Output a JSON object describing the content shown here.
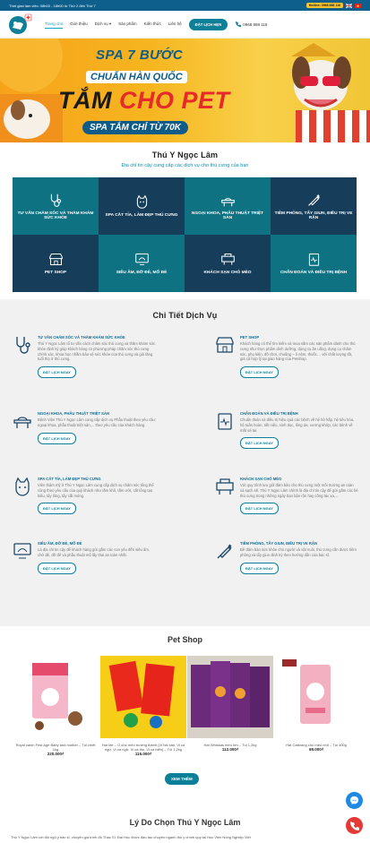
{
  "topbar": {
    "hours": "Thời gian làm việc: 08h00 - 18h00 từ Thứ 2 đến Thứ 7",
    "hotline_label": "Hotline: 0968 888 118"
  },
  "nav": {
    "items": [
      "Trang chủ",
      "Giới thiệu",
      "Dịch vụ",
      "Sản phẩm",
      "Kiến thức",
      "Liên hệ"
    ],
    "book": "ĐẶT LỊCH HẸN",
    "phone": "0968 888 118"
  },
  "banner": {
    "line1": "SPA 7 BƯỚC",
    "line2": "CHUẨN HÀN QUỐC",
    "line3a": "TẮM ",
    "line3b": "CHO PET",
    "line4": "SPA TẮM CHỈ TỪ 70K"
  },
  "intro": {
    "title": "Thú Y Ngọc Lâm",
    "subtitle": "Địa chỉ tin cậy cung cấp các dịch vụ cho thú cưng của bạn"
  },
  "services": [
    "TƯ VẤN CHĂM SÓC VÀ THĂM KHÁM SỨC KHỎE",
    "SPA CẮT TỈA, LÀM ĐẸP THÚ CƯNG",
    "NGOẠI KHOA, PHẪU THUẬT TRIỆT SẢN",
    "TIÊM PHÒNG, TẨY GIUN, ĐIỀU TRỊ VE RẬN",
    "PET SHOP",
    "SIÊU ÂM, ĐỠ ĐẺ, MỔ ĐẺ",
    "KHÁCH SẠN CHÓ MÈO",
    "CHẨN ĐOÁN VÀ ĐIỀU TRỊ BỆNH"
  ],
  "details": {
    "title": "Chi Tiết Dịch Vụ",
    "book": "ĐẶT LỊCH NGAY",
    "items": [
      {
        "h": "TƯ VẤN CHĂM SÓC VÀ THĂM KHÁM SỨC KHỎE",
        "p": "Thú Y Ngọc Lâm tổ tư vấn cách chăm sóc thú cưng và thăm khám sức khỏe định kỳ giúp khách hàng có phương pháp chăm sóc thú cưng chính xác, khoa học nhằm bảo vệ sức khỏe của thú cưng và giá tăng tuổi thọ ở thú cưng."
      },
      {
        "h": "PET SHOP",
        "p": "Khách hàng có thể tìm kiếm và mua sắm các sản phẩm dành cho thú cưng như thực phẩm dinh dưỡng, dụng cụ ăn uống, dụng cụ chăm sóc, phụ kiện, đồ chơi, chuồng – ô nệm, thuốc… với chất lượng tốt, giá cả hợp lý tại giao hàng của Petshop."
      },
      {
        "h": "NGOẠI KHOA, PHẪU THUẬT TRIỆT SẢN",
        "p": "Bệnh Viện Thú Y Ngọc Lâm cung cấp dịch vụ Phẫu thuật theo yêu cầu: ngoại khoa, phẫu thuật triệt sản,... theo yêu cầu của khách hàng."
      },
      {
        "h": "CHẨN ĐOÁN VÀ ĐIỀU TRỊ BỆNH",
        "p": "Chuẩn đoán và điều trị hiệu quả các bệnh về hệ hô hấp, hệ tiêu hóa, hệ tuần hoàn, tiết niệu, sinh dục, lông da, xương khớp, các bệnh về mắt và tai."
      },
      {
        "h": "SPA CẮT TỈA, LÀM ĐẸP THÚ CƯNG",
        "p": "Viên thảm mỹ ở Thú Y Ngọc Lâm cung cấp dịch vụ chăm sóc tổng thể cùng theo yêu cầu của quý khách như tắm khô, tắm ướt, cắt lông tạo kiểu, tẩy lông, tẩy cắt móng."
      },
      {
        "h": "KHÁCH SẠN CHÓ MÈO",
        "p": "Với quy trình lưu giữ đảm bảo cho thú cưng một môi trường an toàn và sạch sẽ. Thú Y Ngọc Lâm chính là địa chỉ tin cậy để gửi gắm các bé thú cưng trong những ngày bạn bận rộn hay công tác xa,..."
      },
      {
        "h": "SIÊU ÂM, ĐỠ ĐẺ, MỔ ĐẺ",
        "p": "Là địa chỉ tin cậy để khách hàng gửi gắm các con yêu đến siêu âm, chờ đẻ, đỡ đẻ và phẫu thuật mổ lấy thai an toàn nhất."
      },
      {
        "h": "TIÊM PHÒNG, TẨY GIUN, ĐIỀU TRỊ VE RẬN",
        "p": "Đề đảm bảo sức khỏe cho người và vật nuôi, thú cưng cần được tiêm phòng và tẩy giun định kỳ theo hướng dẫn của bác sĩ."
      }
    ]
  },
  "shop": {
    "title": "Pet Shop",
    "products": [
      {
        "name": "Royal canin First Age Baby and mother – Túi chiết 1kg",
        "price": "220.000₫"
      },
      {
        "name": "Hạt Me – O cho mèo trưởng thành (Vị hải sản, Vị cá ngừ, Vị cá ngừ, Vị cá thu, Vị cá biển) – Túi 1,2kg",
        "price": "115.000₫"
      },
      {
        "name": "Hạt Whiskas mèo lớn – Túi 1,2kg",
        "price": "112.000₫"
      },
      {
        "name": "Hạt Catsrang cho mèo nhỏ – Túi 400g",
        "price": "69.000₫"
      }
    ],
    "more": "XEM THÊM"
  },
  "why": {
    "title": "Lý Do Chọn Thú Y Ngọc Lâm",
    "text": "Thú Y Ngọc Lâm với đội ngũ y bác sĩ, chuyên gia trình độ Thạc Sĩ, Đại Học được đào tạo chuyên ngành thú y chính quy tại Học Viện Nông Nghiệp Việt"
  },
  "colors": {
    "dark_cell": "#163e5b",
    "teal_cell": "#0f7283",
    "accent": "#0e7f99",
    "banner": "#f7a21b"
  }
}
